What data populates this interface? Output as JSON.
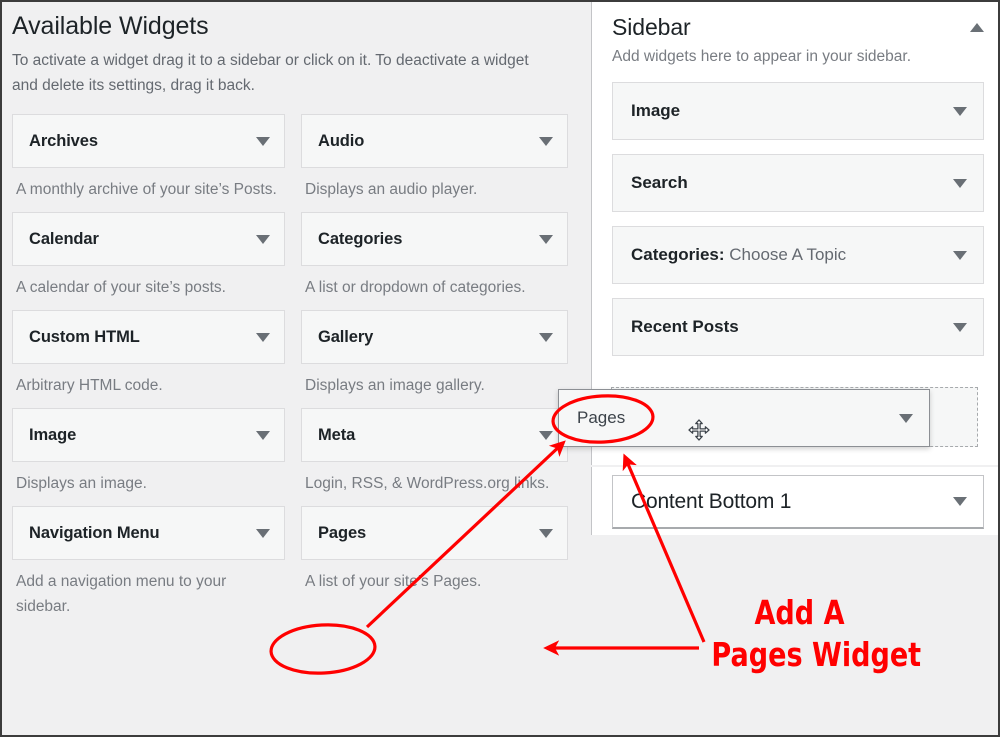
{
  "available": {
    "title": "Available Widgets",
    "description": "To activate a widget drag it to a sidebar or click on it. To deactivate a widget and delete its settings, drag it back.",
    "widgets": [
      {
        "name": "Archives",
        "description": "A monthly archive of your site’s Posts."
      },
      {
        "name": "Audio",
        "description": "Displays an audio player."
      },
      {
        "name": "Calendar",
        "description": "A calendar of your site’s posts."
      },
      {
        "name": "Categories",
        "description": "A list or dropdown of categories."
      },
      {
        "name": "Custom HTML",
        "description": "Arbitrary HTML code."
      },
      {
        "name": "Gallery",
        "description": "Displays an image gallery."
      },
      {
        "name": "Image",
        "description": "Displays an image."
      },
      {
        "name": "Meta",
        "description": "Login, RSS, & WordPress.org links."
      },
      {
        "name": "Navigation Menu",
        "description": "Add a navigation menu to your sidebar."
      },
      {
        "name": "Pages",
        "description": "A list of your site’s Pages."
      }
    ]
  },
  "sidebar_panel": {
    "title": "Sidebar",
    "description": "Add widgets here to appear in your sidebar.",
    "collapse_icon": "chevron-up-icon",
    "widgets": [
      {
        "name": "Image",
        "detail": ""
      },
      {
        "name": "Search",
        "detail": ""
      },
      {
        "name": "Categories:",
        "detail": "Choose A Topic"
      },
      {
        "name": "Recent Posts",
        "detail": ""
      }
    ]
  },
  "drag": {
    "widget_name": "Pages",
    "cursor_icon": "move-cursor-icon",
    "placeholder_label": ""
  },
  "content_bottom_panel": {
    "title": "Content Bottom 1",
    "expand_icon": "chevron-down-icon"
  },
  "annotation": {
    "line1": "Add A",
    "line2": "Pages Widget",
    "color": "#ff0000"
  },
  "icons": {
    "caret_down": "chevron-down-icon",
    "caret_up": "chevron-up-icon"
  }
}
